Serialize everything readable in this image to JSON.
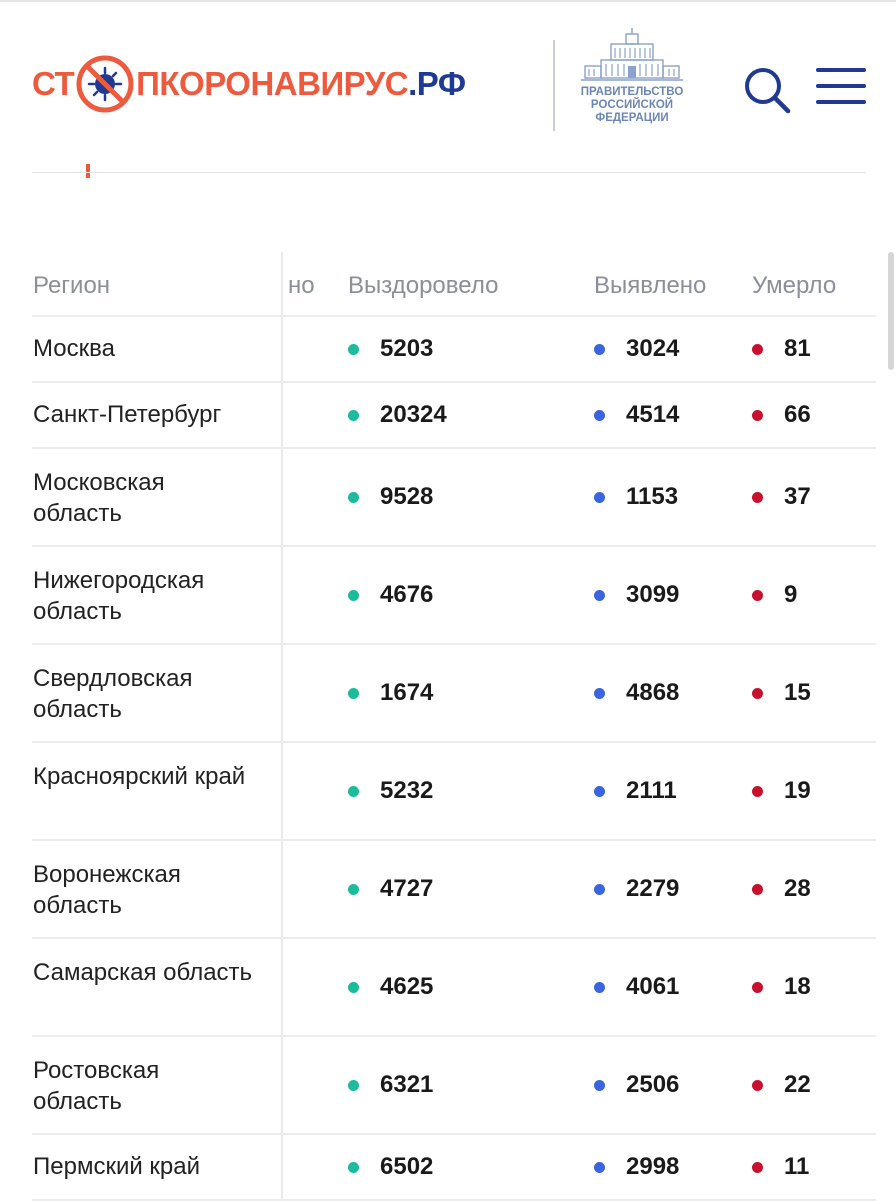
{
  "header": {
    "logo_part1": "СТ",
    "logo_part2": "ПКОРОНАВИРУС",
    "logo_part3": ".РФ",
    "gov_line1": "ПРАВИТЕЛЬСТВО",
    "gov_line2": "РОССИЙСКОЙ",
    "gov_line3": "ФЕДЕРАЦИИ"
  },
  "colors": {
    "recovered": "#1abc9c",
    "detected": "#3a64e0",
    "died": "#c8102e",
    "brand_orange": "#ee5a3d",
    "brand_blue": "#1f3a93"
  },
  "table": {
    "headers": {
      "region": "Регион",
      "partial": "но",
      "recovered": "Выздоровело",
      "detected": "Выявлено",
      "died": "Умерло"
    },
    "rows": [
      {
        "region": "Москва",
        "recovered": "5203",
        "detected": "3024",
        "died": "81"
      },
      {
        "region": "Санкт-Петербург",
        "recovered": "20324",
        "detected": "4514",
        "died": "66"
      },
      {
        "region": "Московская область",
        "recovered": "9528",
        "detected": "1153",
        "died": "37"
      },
      {
        "region": "Нижегородская область",
        "recovered": "4676",
        "detected": "3099",
        "died": "9"
      },
      {
        "region": "Свердловская область",
        "recovered": "1674",
        "detected": "4868",
        "died": "15"
      },
      {
        "region": "Красноярский край",
        "recovered": "5232",
        "detected": "2111",
        "died": "19"
      },
      {
        "region": "Воронежская область",
        "recovered": "4727",
        "detected": "2279",
        "died": "28"
      },
      {
        "region": "Самарская область",
        "recovered": "4625",
        "detected": "4061",
        "died": "18"
      },
      {
        "region": "Ростовская область",
        "recovered": "6321",
        "detected": "2506",
        "died": "22"
      },
      {
        "region": "Пермский край",
        "recovered": "6502",
        "detected": "2998",
        "died": "11"
      }
    ]
  }
}
